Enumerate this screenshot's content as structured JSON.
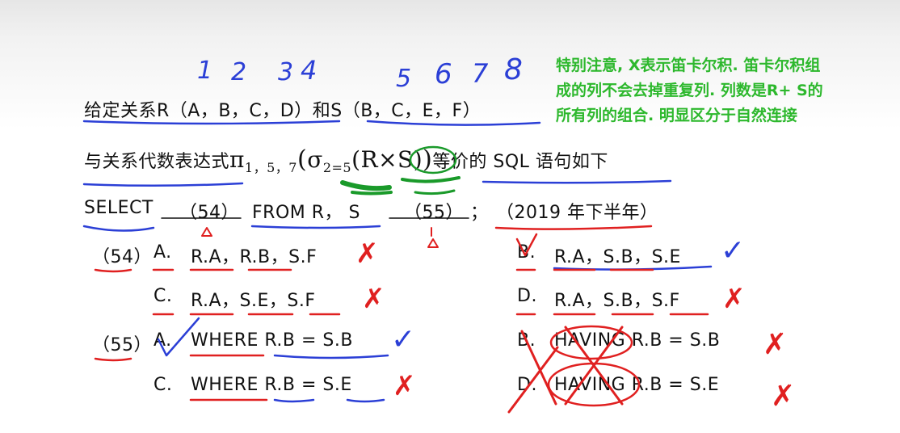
{
  "note": [
    "特别注意, X表示笛卡尔积. 笛卡尔积组",
    "成的列不会去掉重复列. 列数是R+ S的",
    "所有列的组合. 明显区分于自然连接"
  ],
  "handwritten_numbers": [
    "1",
    "2",
    "3",
    "4",
    "5",
    "6",
    "7",
    "8"
  ],
  "question": {
    "line1": "给定关系R（A，B，C，D）和S（B，C，E，F）",
    "line2_prefix": "与关系代数表达式",
    "pi": "π",
    "pi_subscript": "1，5，7",
    "sigma": "σ",
    "sigma_subscript": "2=5",
    "cross_expr": "(R×S)",
    "line2_suffix": "等价的 SQL 语句如下",
    "select": "SELECT",
    "blank1": "（54）",
    "from_clause": "FROM  R，  S",
    "blank2": "（55）",
    "semicolon": "；",
    "year": "（2019 年下半年）"
  },
  "q54": {
    "number": "（54）",
    "options": [
      {
        "letter": "A.",
        "text": "R.A，R.B，S.F",
        "mark": "✗"
      },
      {
        "letter": "B.",
        "text": "R.A，S.B，S.E",
        "mark": "✓"
      },
      {
        "letter": "C.",
        "text": "R.A，S.E，S.F",
        "mark": "✗"
      },
      {
        "letter": "D.",
        "text": "R.A，S.B，S.F",
        "mark": "✗"
      }
    ]
  },
  "q55": {
    "number": "（55）",
    "options": [
      {
        "letter": "A.",
        "text": "WHERE R.B = S.B",
        "mark": "✓"
      },
      {
        "letter": "B.",
        "text": "HAVING R.B = S.B",
        "mark": "✗"
      },
      {
        "letter": "C.",
        "text": "WHERE R.B = S.E",
        "mark": "✗"
      },
      {
        "letter": "D.",
        "text": "HAVING R.B = S.E",
        "mark": "✗"
      }
    ]
  },
  "colors": {
    "note_green": "#2db82d",
    "ink_blue": "#2b3fd6",
    "ink_red": "#e02020",
    "ink_green": "#1a9a2a"
  }
}
